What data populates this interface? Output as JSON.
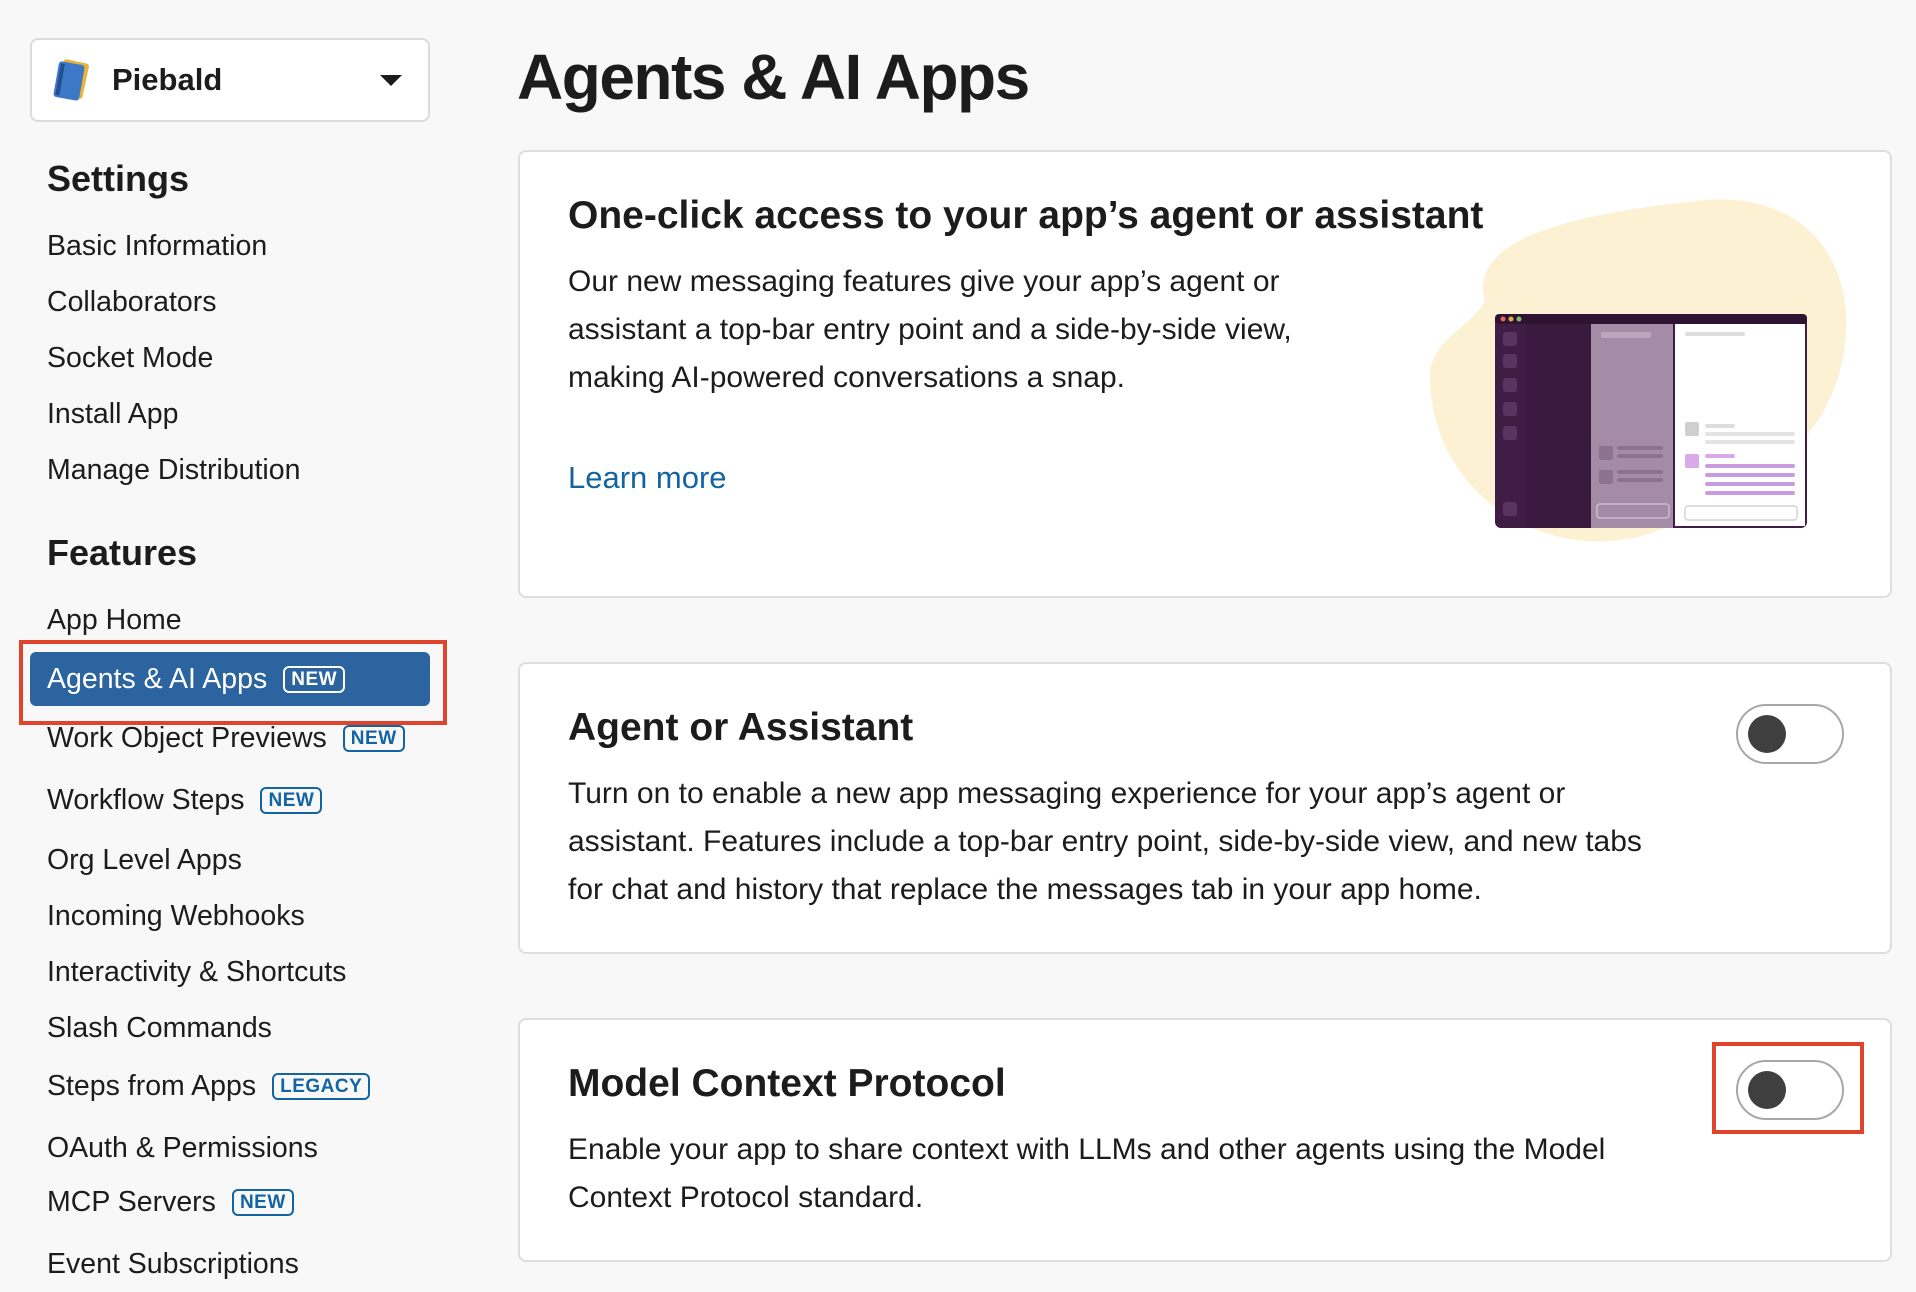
{
  "app": {
    "name": "Piebald"
  },
  "page": {
    "title": "Agents & AI Apps"
  },
  "sidebar": {
    "settings_title": "Settings",
    "settings_items": [
      {
        "label": "Basic Information"
      },
      {
        "label": "Collaborators"
      },
      {
        "label": "Socket Mode"
      },
      {
        "label": "Install App"
      },
      {
        "label": "Manage Distribution"
      }
    ],
    "features_title": "Features",
    "features_items": [
      {
        "label": "App Home",
        "badge": ""
      },
      {
        "label": "Agents & AI Apps",
        "badge": "NEW",
        "active": true
      },
      {
        "label": "Work Object Previews",
        "badge": "NEW"
      },
      {
        "label": "Workflow Steps",
        "badge": "NEW"
      },
      {
        "label": "Org Level Apps",
        "badge": ""
      },
      {
        "label": "Incoming Webhooks",
        "badge": ""
      },
      {
        "label": "Interactivity & Shortcuts",
        "badge": ""
      },
      {
        "label": "Slash Commands",
        "badge": ""
      },
      {
        "label": "Steps from Apps",
        "badge": "LEGACY"
      },
      {
        "label": "OAuth & Permissions",
        "badge": ""
      },
      {
        "label": "MCP Servers",
        "badge": "NEW"
      },
      {
        "label": "Event Subscriptions",
        "badge": ""
      }
    ]
  },
  "promo_card": {
    "title": "One-click access to your app’s agent or assistant",
    "description_lines": [
      "Our new messaging features give your app’s agent or",
      "assistant a top-bar entry point and a side-by-side view,",
      "making AI-powered conversations a snap."
    ],
    "link_label": "Learn more"
  },
  "agent_card": {
    "title": "Agent or Assistant",
    "description_lines": [
      "Turn on to enable a new app messaging experience for your app’s agent or",
      "assistant. Features include a top-bar entry point, side-by-side view, and new tabs",
      "for chat and history that replace the messages tab in your app home."
    ],
    "toggle_on": false
  },
  "mcp_card": {
    "title": "Model Context Protocol",
    "description_lines": [
      "Enable your app to share context with LLMs and other agents using the Model",
      "Context Protocol standard."
    ],
    "toggle_on": false
  },
  "colors": {
    "accent": "#2c64a0",
    "link": "#1264a3",
    "highlight": "#e0442c",
    "illustration_blob": "#fdf1d3"
  }
}
